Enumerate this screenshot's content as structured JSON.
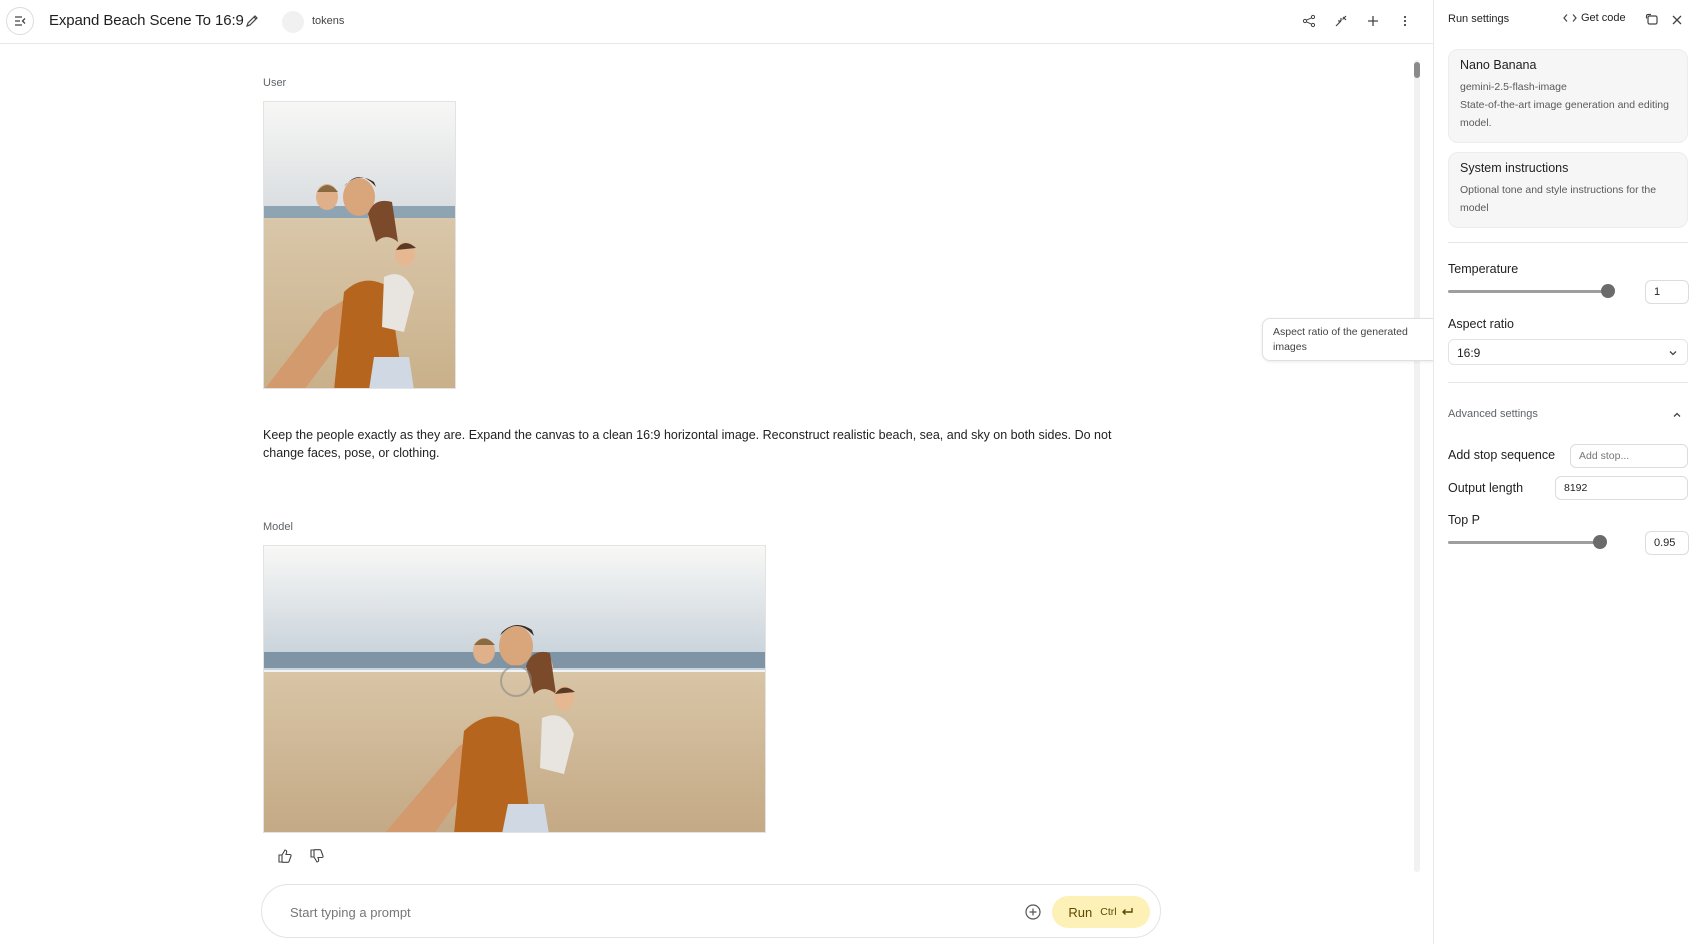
{
  "header": {
    "title": "Expand Beach Scene To 16:9",
    "tokens_label": "tokens"
  },
  "chat": {
    "user_role": "User",
    "user_prompt": "Keep the people exactly as they are. Expand the canvas to a clean 16:9 horizontal image. Reconstruct realistic beach, sea, and sky on both sides. Do not change faces, pose, or clothing.",
    "model_role": "Model"
  },
  "composer": {
    "placeholder": "Start typing a prompt",
    "run_label": "Run",
    "run_shortcut": "Ctrl"
  },
  "tooltip": {
    "text": "Aspect ratio of the generated images"
  },
  "settings": {
    "title": "Run settings",
    "get_code": "Get code",
    "model": {
      "name": "Nano Banana",
      "id": "gemini-2.5-flash-image",
      "description": "State-of-the-art image generation and editing model."
    },
    "system_instructions": {
      "title": "System instructions",
      "description": "Optional tone and style instructions for the model"
    },
    "temperature": {
      "label": "Temperature",
      "value": "1",
      "level": 1.0
    },
    "aspect_ratio": {
      "label": "Aspect ratio",
      "value": "16:9"
    },
    "advanced": {
      "label": "Advanced settings",
      "stop_sequence_label": "Add stop sequence",
      "stop_sequence_placeholder": "Add stop...",
      "output_length_label": "Output length",
      "output_length_value": "8192",
      "top_p_label": "Top P",
      "top_p_value": "0.95",
      "top_p_level": 0.95
    }
  }
}
